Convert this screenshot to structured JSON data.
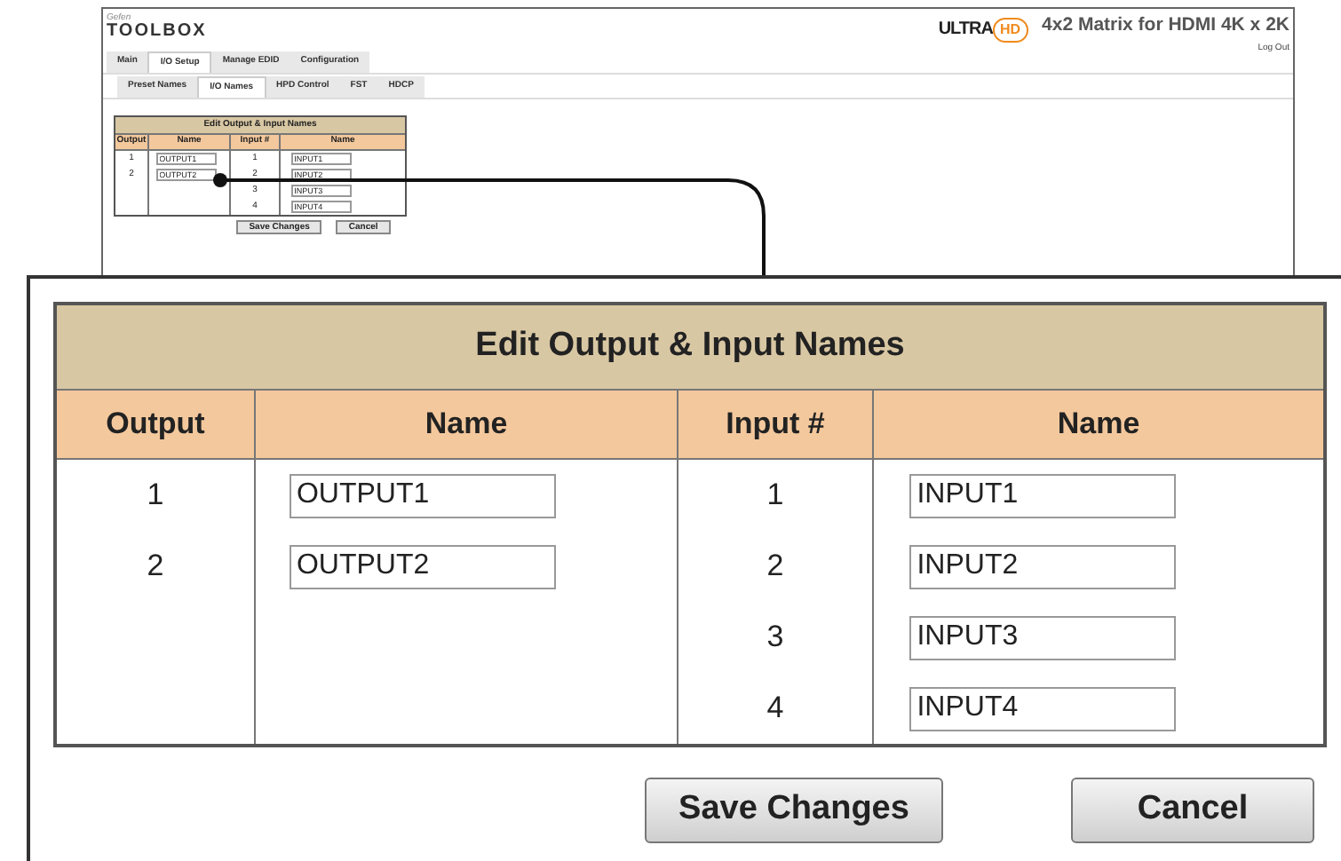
{
  "screen": {
    "brand_small": "Gefen",
    "brand": "TOOLBOX",
    "ultra": "ULTRA",
    "hd": "HD",
    "title": "4x2 Matrix for HDMI 4K x 2K",
    "logout": "Log Out",
    "tabs": [
      {
        "label": "Main",
        "selected": false
      },
      {
        "label": "I/O Setup",
        "selected": true
      },
      {
        "label": "Manage EDID",
        "selected": false
      },
      {
        "label": "Configuration",
        "selected": false
      }
    ],
    "subtabs": [
      {
        "label": "Preset Names",
        "selected": false
      },
      {
        "label": "I/O Names",
        "selected": true
      },
      {
        "label": "HPD Control",
        "selected": false
      },
      {
        "label": "FST",
        "selected": false
      },
      {
        "label": "HDCP",
        "selected": false
      }
    ],
    "table": {
      "title": "Edit Output & Input Names",
      "columns": [
        "Output",
        "Name",
        "Input #",
        "Name"
      ],
      "outputs": [
        {
          "number": "1",
          "name": "OUTPUT1"
        },
        {
          "number": "2",
          "name": "OUTPUT2"
        }
      ],
      "inputs": [
        {
          "number": "1",
          "name": "INPUT1"
        },
        {
          "number": "2",
          "name": "INPUT2"
        },
        {
          "number": "3",
          "name": "INPUT3"
        },
        {
          "number": "4",
          "name": "INPUT4"
        }
      ]
    },
    "buttons": [
      "Save Changes",
      "Cancel"
    ]
  },
  "callout": {
    "table": {
      "title": "Edit Output & Input Names",
      "columns": [
        "Output",
        "Name",
        "Input #",
        "Name"
      ],
      "outputs": [
        {
          "number": "1",
          "name": "OUTPUT1"
        },
        {
          "number": "2",
          "name": "OUTPUT2"
        }
      ],
      "inputs": [
        {
          "number": "1",
          "name": "INPUT1"
        },
        {
          "number": "2",
          "name": "INPUT2"
        },
        {
          "number": "3",
          "name": "INPUT3"
        },
        {
          "number": "4",
          "name": "INPUT4"
        }
      ]
    },
    "buttons": [
      "Save Changes",
      "Cancel"
    ]
  }
}
